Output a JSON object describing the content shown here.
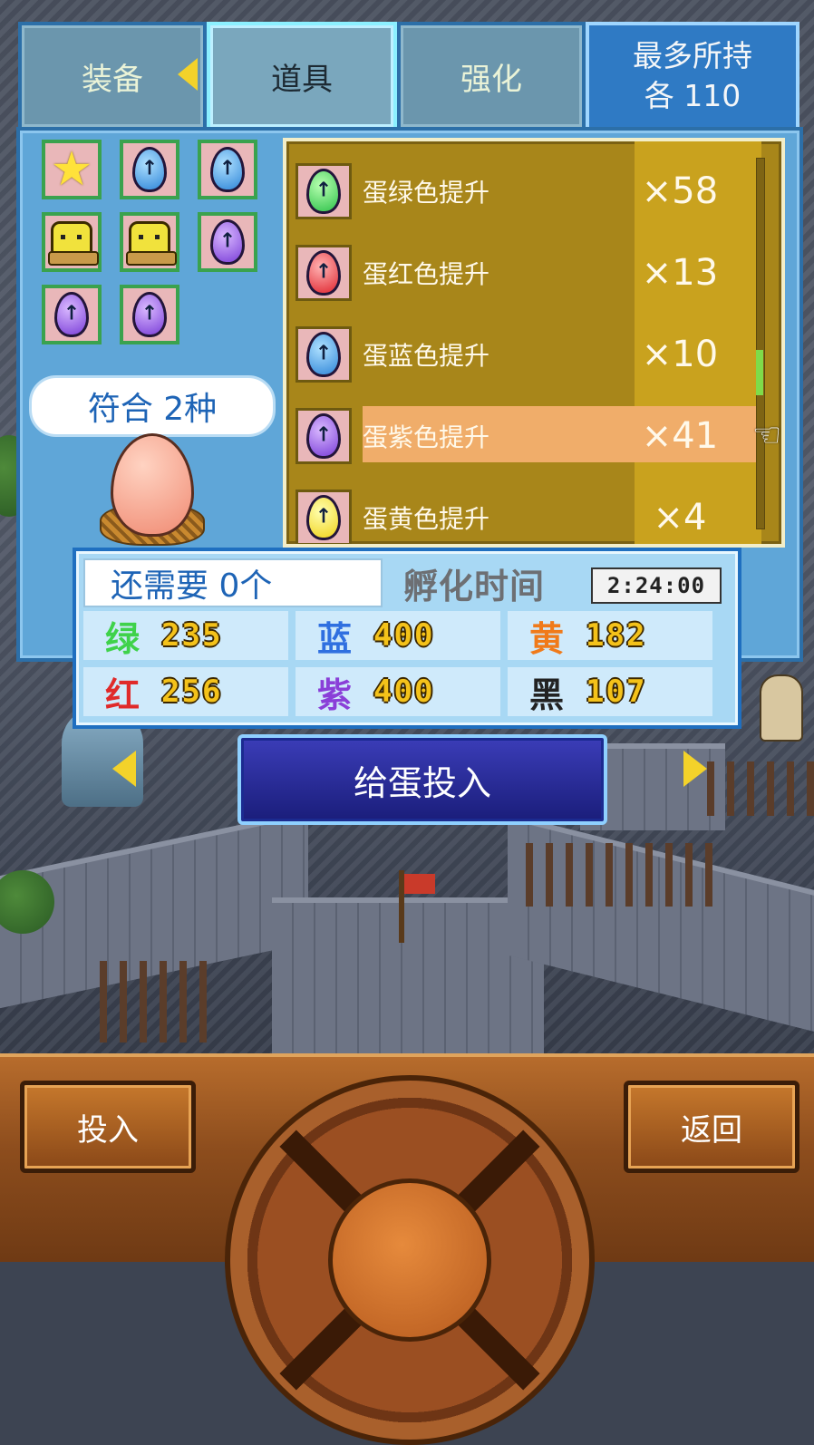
{
  "tabs": [
    {
      "label": "装备",
      "active": false
    },
    {
      "label": "道具",
      "active": true
    },
    {
      "label": "强化",
      "active": false
    }
  ],
  "max_hold": {
    "line1": "最多所持",
    "line2": "各 110"
  },
  "owned_icons": [
    "star-icon",
    "blue-egg-icon",
    "blue-egg-icon",
    "chick-icon",
    "chick-icon",
    "purple-egg-icon",
    "purple-egg-icon",
    "purple-egg-icon"
  ],
  "match_text": "符合 2种",
  "items": [
    {
      "name": "蛋绿色提升",
      "qty": "×58",
      "color": "green"
    },
    {
      "name": "蛋红色提升",
      "qty": "×13",
      "color": "red"
    },
    {
      "name": "蛋蓝色提升",
      "qty": "×10",
      "color": "blue"
    },
    {
      "name": "蛋紫色提升",
      "qty": "×41",
      "color": "purple"
    },
    {
      "name": "蛋黄色提升",
      "qty": "×4",
      "color": "yellow"
    }
  ],
  "selected_item": "蛋紫色提升",
  "need_text": "还需要 0个",
  "hatch_label": "孵化时间",
  "hatch_time": "2:24:00",
  "stats": [
    {
      "label": "绿",
      "value": "235",
      "color": "#3fd24a"
    },
    {
      "label": "蓝",
      "value": "400",
      "color": "#2f6fe0"
    },
    {
      "label": "黄",
      "value": "182",
      "color": "#f07a1a"
    },
    {
      "label": "红",
      "value": "256",
      "color": "#e02a2a"
    },
    {
      "label": "紫",
      "value": "400",
      "color": "#8a3fd8"
    },
    {
      "label": "黑",
      "value": "107",
      "color": "#222222"
    }
  ],
  "feed_button": "给蛋投入",
  "bottom": {
    "left_button": "投入",
    "right_button": "返回"
  }
}
